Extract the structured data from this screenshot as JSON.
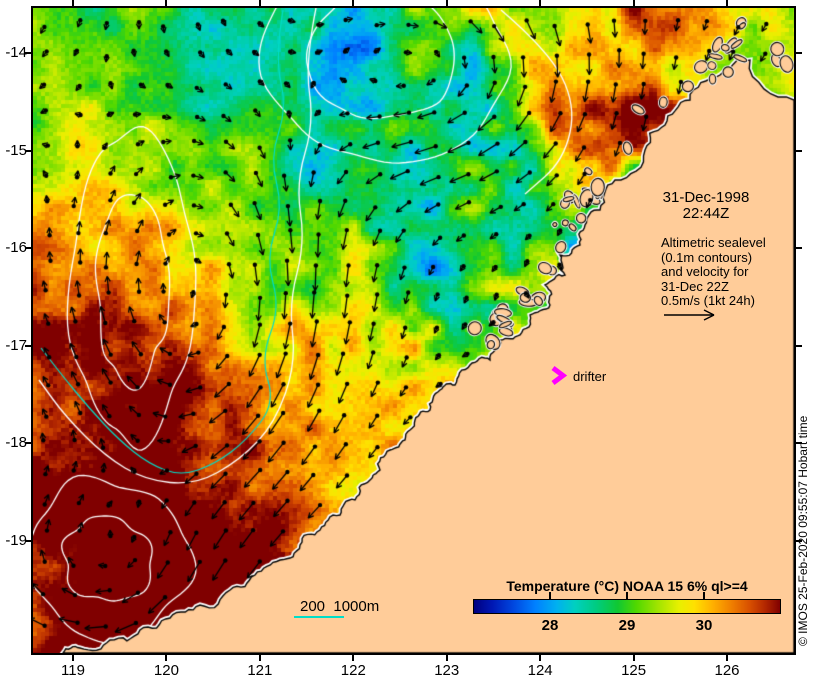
{
  "map": {
    "date_line1": "31-Dec-1998",
    "date_line2": "22:44Z",
    "anno_lines": [
      "Altimetric sealevel",
      "(0.1m contours)",
      "and velocity for",
      "31-Dec 22Z",
      "0.5m/s (1kt 24h)"
    ],
    "drifter_label": "drifter",
    "depth_legend": "200  1000m",
    "land_color": "#FFCC99",
    "drifter_color": "#FF00FF",
    "contour_sealevel_color": "#FFFFFF",
    "contour_depth_color": "#00DDC8",
    "vector_color": "#000000"
  },
  "axes": {
    "x_labels": [
      "119",
      "120",
      "121",
      "122",
      "123",
      "124",
      "125",
      "126"
    ],
    "y_labels": [
      "-14",
      "-15",
      "-16",
      "-17",
      "-18",
      "-19"
    ]
  },
  "colorbar": {
    "title": "Temperature (°C) NOAA 15 6% ql>=4",
    "tick_labels": [
      "28",
      "29",
      "30"
    ],
    "range": [
      27,
      31
    ],
    "palette": [
      {
        "pos": 0.0,
        "color": "#000080"
      },
      {
        "pos": 0.06,
        "color": "#0018B4"
      },
      {
        "pos": 0.13,
        "color": "#0048E0"
      },
      {
        "pos": 0.2,
        "color": "#0080FF"
      },
      {
        "pos": 0.27,
        "color": "#00B0F0"
      },
      {
        "pos": 0.33,
        "color": "#00D0C0"
      },
      {
        "pos": 0.4,
        "color": "#00CC80"
      },
      {
        "pos": 0.47,
        "color": "#10C832"
      },
      {
        "pos": 0.53,
        "color": "#50D800"
      },
      {
        "pos": 0.6,
        "color": "#A0E400"
      },
      {
        "pos": 0.67,
        "color": "#E8F000"
      },
      {
        "pos": 0.72,
        "color": "#FFE000"
      },
      {
        "pos": 0.78,
        "color": "#FFB000"
      },
      {
        "pos": 0.84,
        "color": "#F08000"
      },
      {
        "pos": 0.9,
        "color": "#D85000"
      },
      {
        "pos": 0.95,
        "color": "#B42800"
      },
      {
        "pos": 1.0,
        "color": "#800000"
      }
    ]
  },
  "copyright": "© IMOS 25-Feb-2020 09:55:07 Hobart time"
}
